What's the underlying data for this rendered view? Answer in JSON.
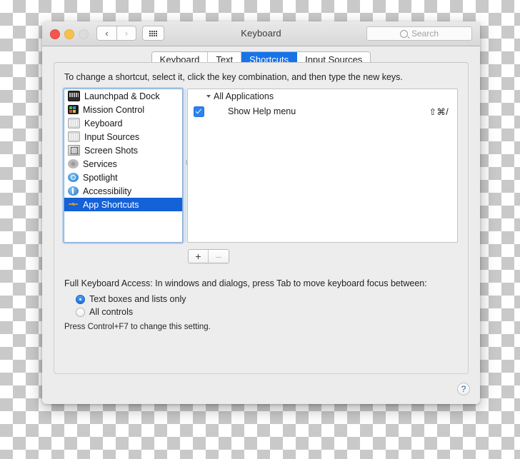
{
  "window": {
    "title": "Keyboard",
    "traffic_lights": [
      "close",
      "minimize",
      "zoom"
    ],
    "nav_back": "‹",
    "nav_forward": "›",
    "grid_icon": "grid-icon",
    "search": {
      "placeholder": "Search",
      "value": ""
    },
    "help_label": "?"
  },
  "tabs": [
    {
      "label": "Keyboard",
      "active": false
    },
    {
      "label": "Text",
      "active": false
    },
    {
      "label": "Shortcuts",
      "active": true
    },
    {
      "label": "Input Sources",
      "active": false
    }
  ],
  "main": {
    "instruction": "To change a shortcut, select it, click the key combination, and then type the new keys.",
    "categories": [
      {
        "label": "Launchpad & Dock",
        "icon": "launchpad-icon",
        "selected": false
      },
      {
        "label": "Mission Control",
        "icon": "mission-control-icon",
        "selected": false
      },
      {
        "label": "Keyboard",
        "icon": "keyboard-icon",
        "selected": false
      },
      {
        "label": "Input Sources",
        "icon": "input-sources-icon",
        "selected": false
      },
      {
        "label": "Screen Shots",
        "icon": "screenshot-icon",
        "selected": false
      },
      {
        "label": "Services",
        "icon": "services-gear-icon",
        "selected": false
      },
      {
        "label": "Spotlight",
        "icon": "spotlight-icon",
        "selected": false
      },
      {
        "label": "Accessibility",
        "icon": "accessibility-icon",
        "selected": false
      },
      {
        "label": "App Shortcuts",
        "icon": "app-shortcuts-icon",
        "selected": true
      }
    ],
    "shortcut_group": "All Applications",
    "shortcuts": [
      {
        "name": "Show Help menu",
        "keys": "⇧⌘/",
        "checked": true
      }
    ],
    "add_label": "+",
    "remove_label": "–"
  },
  "full_keyboard_access": {
    "label": "Full Keyboard Access: In windows and dialogs, press Tab to move keyboard focus between:",
    "options": [
      {
        "label": "Text boxes and lists only",
        "selected": true
      },
      {
        "label": "All controls",
        "selected": false
      }
    ],
    "hint": "Press Control+F7 to change this setting."
  },
  "colors": {
    "accent_blue": "#1673e8",
    "selection_blue": "#1461d8",
    "checkbox_blue": "#2b84f0",
    "window_chrome": "#ececec"
  }
}
